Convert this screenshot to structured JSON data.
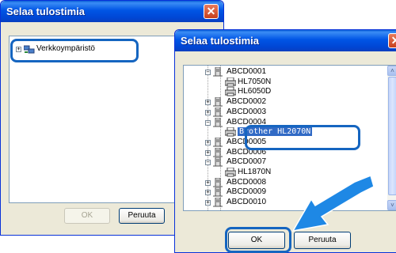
{
  "window1": {
    "title": "Selaa tulostimia",
    "close_glyph": "✕",
    "tree_item": "Verkkoympäristö",
    "expander": "+",
    "ok_label": "OK",
    "cancel_label": "Peruuta"
  },
  "window2": {
    "title": "Selaa tulostimia",
    "ok_label": "OK",
    "cancel_label": "Peruuta",
    "scroll_up": "˄",
    "scroll_down": "˅",
    "tree": [
      {
        "label": "ABCD0001",
        "type": "server",
        "expander": "−"
      },
      {
        "label": "HL7050N",
        "type": "printer"
      },
      {
        "label": "HL6050D",
        "type": "printer"
      },
      {
        "label": "ABCD0002",
        "type": "server",
        "expander": "+"
      },
      {
        "label": "ABCD0003",
        "type": "server",
        "expander": "+"
      },
      {
        "label": "ABCD0004",
        "type": "server",
        "expander": "−"
      },
      {
        "label": "Brother HL2070N",
        "type": "printer",
        "selected": true
      },
      {
        "label": "ABCD0005",
        "type": "server",
        "expander": "+"
      },
      {
        "label": "ABCD0006",
        "type": "server",
        "expander": "+"
      },
      {
        "label": "ABCD0007",
        "type": "server",
        "expander": "−"
      },
      {
        "label": "HL1870N",
        "type": "printer"
      },
      {
        "label": "ABCD0008",
        "type": "server",
        "expander": "+"
      },
      {
        "label": "ABCD0009",
        "type": "server",
        "expander": "+"
      },
      {
        "label": "ABCD0010",
        "type": "server",
        "expander": "+"
      }
    ]
  },
  "colors": {
    "highlight": "#1565c0",
    "selection": "#316ac5",
    "arrow": "#1e88e5"
  }
}
